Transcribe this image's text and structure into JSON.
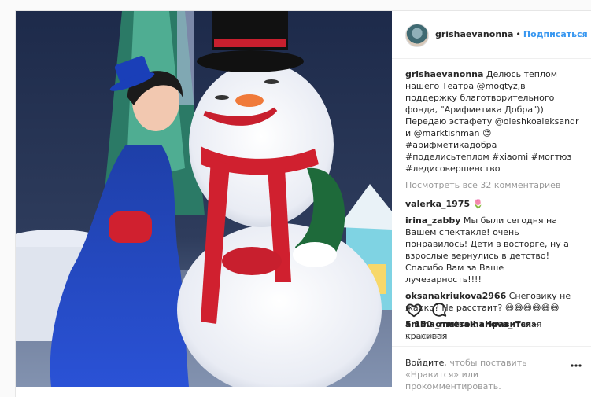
{
  "header": {
    "username": "grishaevanonna",
    "separator": "•",
    "follow_label": "Подписаться"
  },
  "caption": {
    "username": "grishaevanonna",
    "text": "Делюсь теплом нашего Театра @mogtyz,в поддержку благотворительного фонда, \"Арифметика Добра\")) Передаю эстафету @oleshkoaleksandr и @marktishman 😍 #арифметикадобра #поделисьтеплом #xiaomi #могтюз #ледисовершенство"
  },
  "view_all_label": "Посмотреть все 32 комментариев",
  "comments": [
    {
      "user": "valerka_1975",
      "text": "🌷"
    },
    {
      "user": "irina_zabby",
      "text": "Мы были сегодня на Вашем спектакле! очень понравилось! Дети в восторге, ну а взрослые вернулись в детство! Спасибо Вам за Ваше лучезарность!!!!"
    },
    {
      "user": "oksanakriukova2966",
      "text": "Снеговику не жарко? Не расстаит? 😅😅😅😅😅😅"
    },
    {
      "user": "amina_mutsalhanova_",
      "text": "Такая красивая"
    }
  ],
  "likes_label": "5 150 отметок «Нравится»",
  "date_label": "27 ЯНВАРЯ",
  "login_prompt": {
    "link1": "Войдите",
    "mid": ", чтобы поставить «Нравится»",
    "tail": "или прокомментировать."
  },
  "icons": {
    "like": "heart-outline-icon",
    "comment": "speech-bubble-icon",
    "more": "more-options-icon"
  }
}
